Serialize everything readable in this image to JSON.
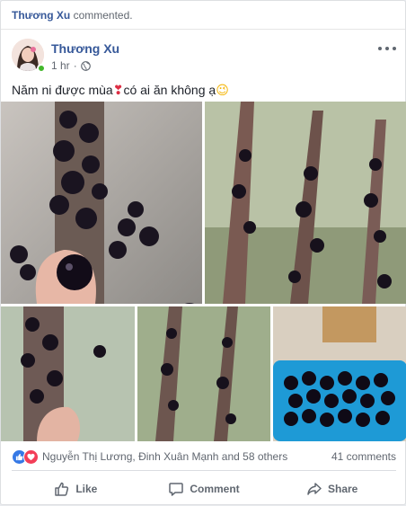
{
  "story": {
    "actor": "Thương Xu",
    "action": "commented."
  },
  "post": {
    "author": "Thương Xu",
    "time": "1 hr",
    "privacy_icon": "globe-icon",
    "text_part1": "Năm ni được mùa",
    "text_emoji_heart": "❣",
    "text_part2": "có ai ăn không ạ",
    "text_emoji_smile": "😉"
  },
  "photos": [
    {
      "name": "photo-1",
      "alt_icon": "photo"
    },
    {
      "name": "photo-2",
      "alt_icon": "photo"
    },
    {
      "name": "photo-3",
      "alt_icon": "photo"
    },
    {
      "name": "photo-4",
      "alt_icon": "photo"
    },
    {
      "name": "photo-5",
      "alt_icon": "photo"
    }
  ],
  "reactions": {
    "names": "Nguyễn Thị Lương, Đinh Xuân Mạnh and 58 others",
    "comments": "41 comments",
    "like_color": "#3578e5",
    "love_color": "#f33e58"
  },
  "actions": {
    "like": "Like",
    "comment": "Comment",
    "share": "Share"
  },
  "colors": {
    "link": "#365899",
    "online": "#42b72a"
  }
}
